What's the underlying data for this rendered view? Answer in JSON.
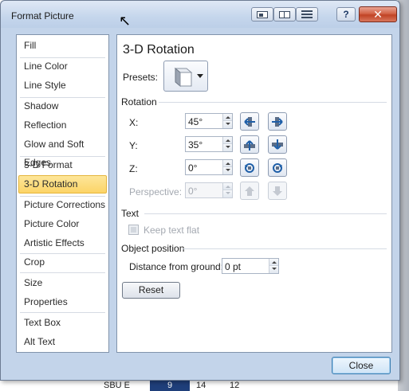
{
  "window": {
    "title": "Format Picture",
    "help_label": "?",
    "close_label": "✕"
  },
  "titlebar_buttons": [
    "layout-icon",
    "columns-icon",
    "rows-icon"
  ],
  "nav": {
    "items": [
      "Fill",
      "Line Color",
      "Line Style",
      "Shadow",
      "Reflection",
      "Glow and Soft Edges",
      "3-D Format",
      "3-D Rotation",
      "Picture Corrections",
      "Picture Color",
      "Artistic Effects",
      "Crop",
      "Size",
      "Properties",
      "Text Box",
      "Alt Text"
    ],
    "selected": "3-D Rotation"
  },
  "panel": {
    "title": "3-D Rotation",
    "presets_label": "Presets:",
    "rotation_section": "Rotation",
    "x_label": "X:",
    "x_value": "45°",
    "y_label": "Y:",
    "y_value": "35°",
    "z_label": "Z:",
    "z_value": "0°",
    "perspective_label": "Perspective:",
    "perspective_value": "0°",
    "text_section": "Text",
    "keep_text_flat": "Keep text flat",
    "object_position_section": "Object position",
    "distance_label": "Distance from ground:",
    "distance_value": "0 pt",
    "reset_label": "Reset"
  },
  "footer": {
    "close_label": "Close"
  },
  "background": {
    "cells": [
      "SBU E",
      "9",
      "14",
      "12"
    ]
  },
  "colors": {
    "dialog_bg": "#c3d4ea",
    "selected_bg": "#fcd467",
    "accent_blue": "#2b6fb6"
  }
}
